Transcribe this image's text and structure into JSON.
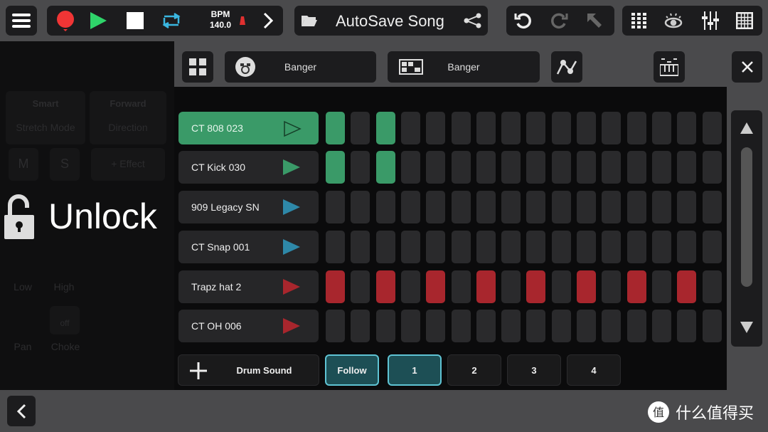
{
  "toolbar": {
    "bpm_label": "BPM",
    "bpm_value": "140.0",
    "song_title": "AutoSave Song"
  },
  "left_panel": {
    "stretch_value": "Smart",
    "stretch_label": "Stretch Mode",
    "direction_value": "Forward",
    "direction_label": "Direction",
    "mute": "M",
    "solo": "S",
    "effect": "+ Effect",
    "low": "Low",
    "high": "High",
    "pan": "Pan",
    "choke_value": "off",
    "choke": "Choke",
    "unlock": "Unlock"
  },
  "instrument": {
    "kit_name": "Banger",
    "pattern_name": "Banger"
  },
  "colors": {
    "green": "#3a9a68",
    "red": "#a8262d",
    "blue": "#2e88a8",
    "off": "#2a2a2c",
    "accent": "#5fc4d4"
  },
  "tracks": [
    {
      "name": "CT 808 023",
      "color": "#3a9a68",
      "selected": true,
      "steps": [
        1,
        0,
        1,
        0,
        0,
        0,
        0,
        0,
        0,
        0,
        0,
        0,
        0,
        0,
        0,
        0
      ]
    },
    {
      "name": "CT Kick 030",
      "color": "#3a9a68",
      "selected": false,
      "steps": [
        1,
        0,
        1,
        0,
        0,
        0,
        0,
        0,
        0,
        0,
        0,
        0,
        0,
        0,
        0,
        0
      ]
    },
    {
      "name": "909 Legacy SN",
      "color": "#2e88a8",
      "selected": false,
      "steps": [
        0,
        0,
        0,
        0,
        0,
        0,
        0,
        0,
        0,
        0,
        0,
        0,
        0,
        0,
        0,
        0
      ]
    },
    {
      "name": "CT Snap 001",
      "color": "#2e88a8",
      "selected": false,
      "steps": [
        0,
        0,
        0,
        0,
        0,
        0,
        0,
        0,
        0,
        0,
        0,
        0,
        0,
        0,
        0,
        0
      ]
    },
    {
      "name": "Trapz hat 2",
      "color": "#a8262d",
      "selected": false,
      "steps": [
        1,
        0,
        1,
        0,
        1,
        0,
        1,
        0,
        1,
        0,
        1,
        0,
        1,
        0,
        1,
        0
      ]
    },
    {
      "name": "CT OH 006",
      "color": "#a8262d",
      "selected": false,
      "steps": [
        0,
        0,
        0,
        0,
        0,
        0,
        0,
        0,
        0,
        0,
        0,
        0,
        0,
        0,
        0,
        0
      ]
    }
  ],
  "bottom": {
    "add_label": "Drum Sound",
    "follow": "Follow",
    "pages": [
      "1",
      "2",
      "3",
      "4"
    ],
    "active_page": "1"
  },
  "watermark": "什么值得买"
}
